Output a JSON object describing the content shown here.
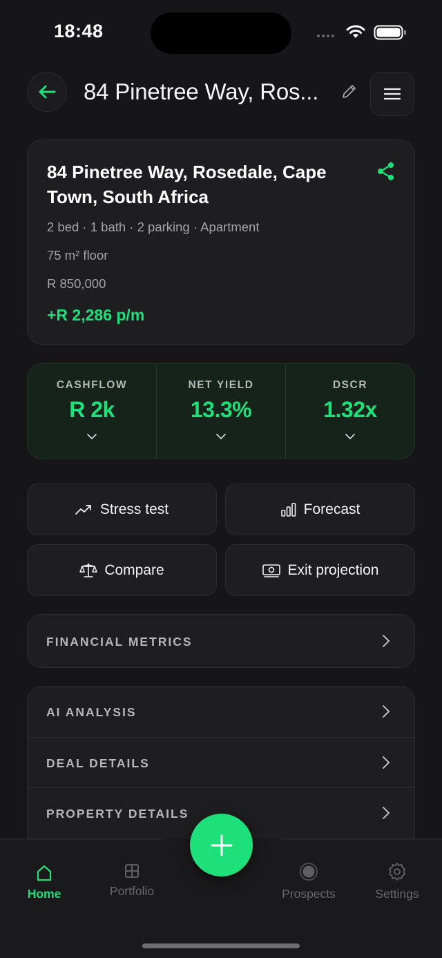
{
  "status": {
    "time": "18:48"
  },
  "header": {
    "title": "84 Pinetree Way, Ros..."
  },
  "property": {
    "address": "84 Pinetree Way, Rosedale, Cape Town, South Africa",
    "specs": "2 bed · 1 bath · 2 parking · Apartment",
    "floor": "75 m² floor",
    "price": "R 850,000",
    "monthly_cashflow": "+R 2,286 p/m"
  },
  "metrics": [
    {
      "label": "CASHFLOW",
      "value": "R 2k"
    },
    {
      "label": "NET YIELD",
      "value": "13.3%"
    },
    {
      "label": "DSCR",
      "value": "1.32x"
    }
  ],
  "actions": {
    "stress_test": "Stress test",
    "forecast": "Forecast",
    "compare": "Compare",
    "exit_projection": "Exit projection"
  },
  "sections": {
    "financial_metrics": "FINANCIAL METRICS",
    "ai_analysis": "AI ANALYSIS",
    "deal_details": "DEAL DETAILS",
    "property_details": "PROPERTY DETAILS"
  },
  "tabbar": {
    "home": "Home",
    "portfolio": "Portfolio",
    "prospects": "Prospects",
    "settings": "Settings",
    "active": "Home"
  },
  "colors": {
    "accent": "#1ee07a",
    "background": "#161618",
    "card": "#1e1e21",
    "metrics_bg": "#15231b"
  }
}
